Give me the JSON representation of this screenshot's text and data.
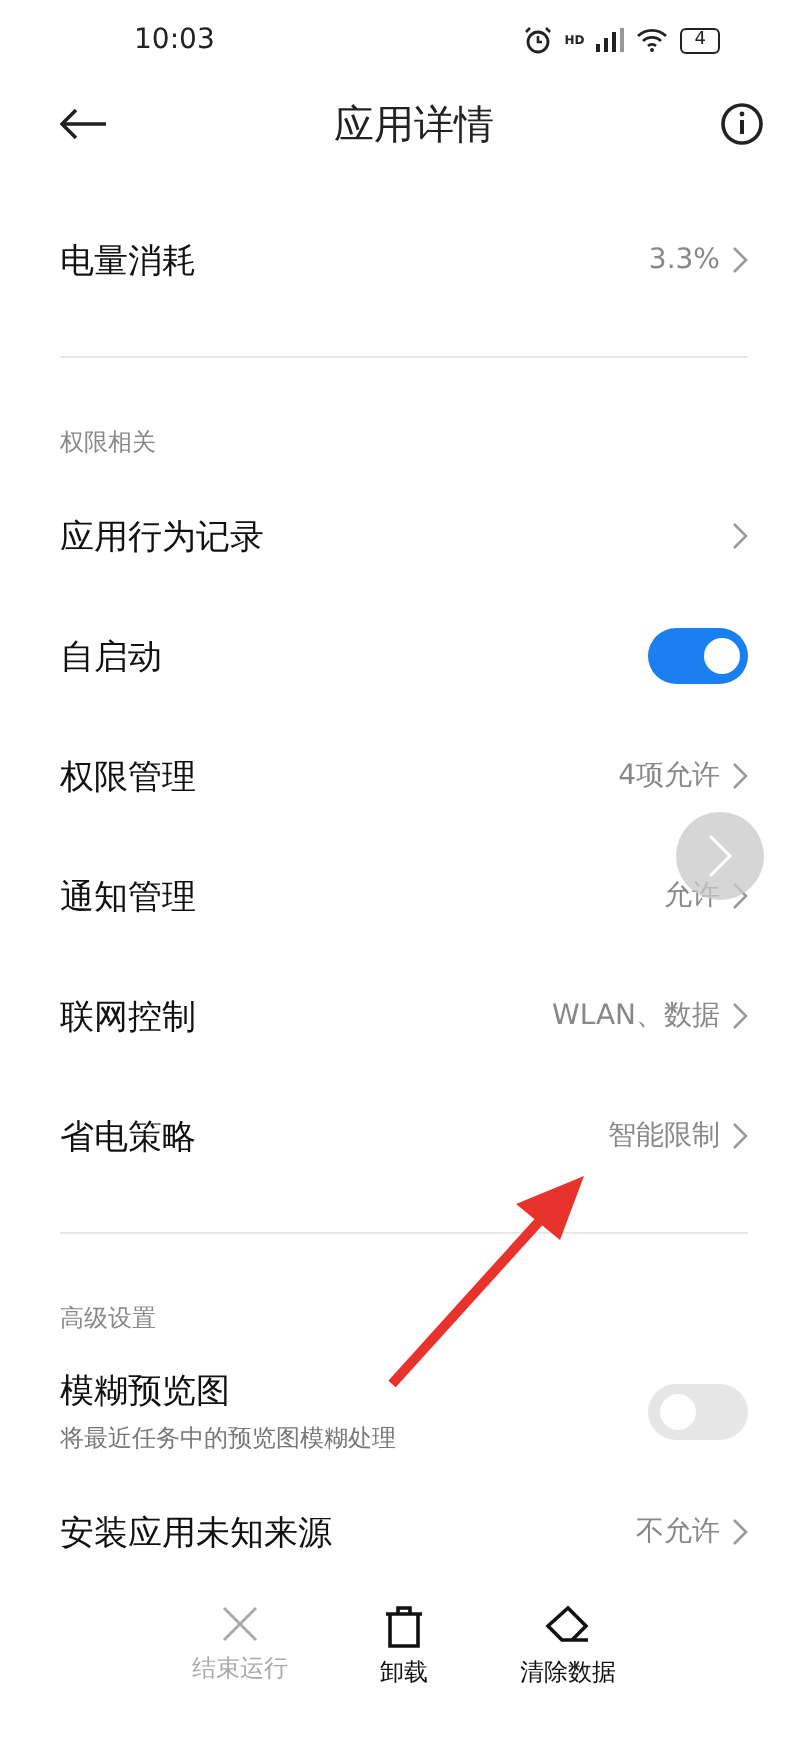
{
  "status_bar": {
    "time": "10:03",
    "network": "HD",
    "battery": "4"
  },
  "header": {
    "title": "应用详情"
  },
  "sections": [
    {
      "items": [
        {
          "kind": "link",
          "label": "电量消耗",
          "value": "3.3%"
        }
      ]
    },
    {
      "title": "权限相关",
      "items": [
        {
          "kind": "link",
          "label": "应用行为记录"
        },
        {
          "kind": "toggle",
          "label": "自启动",
          "on": true
        },
        {
          "kind": "link",
          "label": "权限管理",
          "value": "4项允许"
        },
        {
          "kind": "link",
          "label": "通知管理",
          "value": "允许"
        },
        {
          "kind": "link",
          "label": "联网控制",
          "value": "WLAN、数据"
        },
        {
          "kind": "link",
          "label": "省电策略",
          "value": "智能限制"
        }
      ]
    },
    {
      "title": "高级设置",
      "items": [
        {
          "kind": "toggle",
          "label": "模糊预览图",
          "subtitle": "将最近任务中的预览图模糊处理",
          "on": false
        },
        {
          "kind": "link",
          "label": "安装应用未知来源",
          "value": "不允许"
        }
      ]
    }
  ],
  "actions": [
    {
      "kind": "close",
      "label": "结束运行",
      "disabled": true
    },
    {
      "kind": "trash",
      "label": "卸载",
      "disabled": false
    },
    {
      "kind": "eraser",
      "label": "清除数据",
      "disabled": false
    }
  ]
}
